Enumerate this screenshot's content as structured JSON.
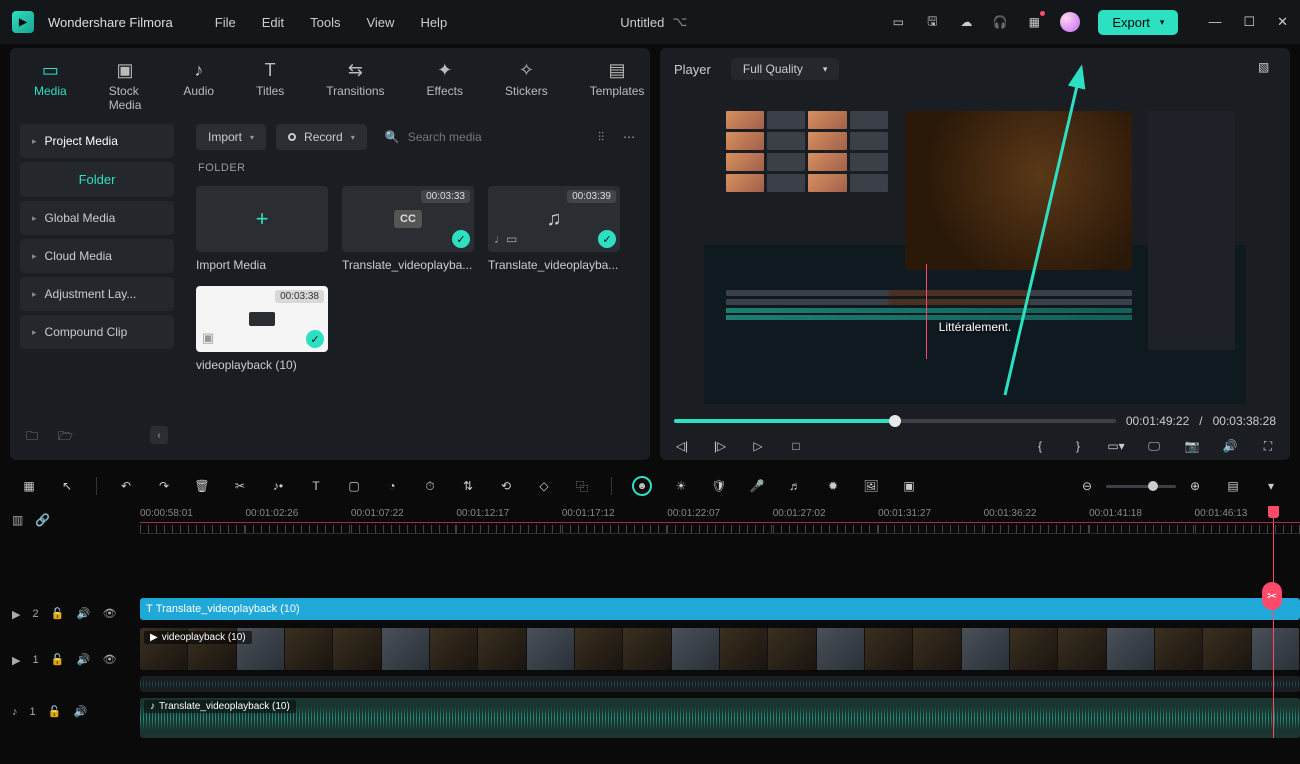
{
  "app": {
    "name": "Wondershare Filmora"
  },
  "menu": {
    "file": "File",
    "edit": "Edit",
    "tools": "Tools",
    "view": "View",
    "help": "Help"
  },
  "doc": {
    "title": "Untitled"
  },
  "export": {
    "label": "Export"
  },
  "tabs": {
    "media": "Media",
    "stock": "Stock Media",
    "audio": "Audio",
    "titles": "Titles",
    "transitions": "Transitions",
    "effects": "Effects",
    "stickers": "Stickers",
    "templates": "Templates"
  },
  "sidebar": {
    "project": "Project Media",
    "folder": "Folder",
    "global": "Global Media",
    "cloud": "Cloud Media",
    "adjust": "Adjustment Lay...",
    "compound": "Compound Clip"
  },
  "toolbar": {
    "import": "Import",
    "record": "Record",
    "search_ph": "Search media"
  },
  "folder_h": "FOLDER",
  "cards": {
    "import": "Import Media",
    "c1": {
      "dur": "00:03:33",
      "name": "Translate_videoplayba..."
    },
    "c2": {
      "dur": "00:03:39",
      "name": "Translate_videoplayba..."
    },
    "c3": {
      "dur": "00:03:38",
      "name": "videoplayback (10)"
    }
  },
  "player": {
    "label": "Player",
    "quality": "Full Quality",
    "subtitle": "Littéralement.",
    "cur": "00:01:49:22",
    "sep": "/",
    "tot": "00:03:38:28"
  },
  "ruler": [
    "00:00:58:01",
    "00:01:02:26",
    "00:01:07:22",
    "00:01:12:17",
    "00:01:17:12",
    "00:01:22:07",
    "00:01:27:02",
    "00:01:31:27",
    "00:01:36:22",
    "00:01:41:18",
    "00:01:46:13"
  ],
  "tracks": {
    "t2": {
      "id": "2"
    },
    "t1v": {
      "id": "1"
    },
    "t1a": {
      "id": "1"
    },
    "sub_clip": "Translate_videoplayback (10)",
    "vid_clip": "videoplayback (10)",
    "aud_clip": "Translate_videoplayback (10)"
  }
}
